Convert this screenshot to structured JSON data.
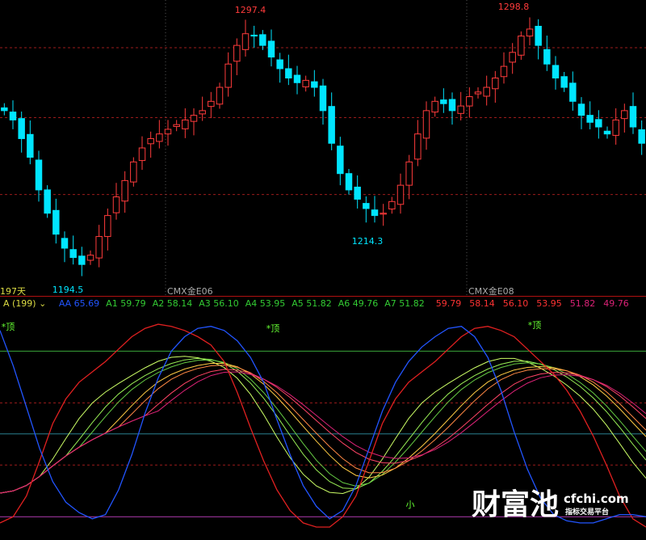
{
  "colors": {
    "up": "#ff3b3b",
    "down": "#00e5ff",
    "grid_red": "#9b1b1b",
    "divider": "#b01010",
    "green_line": "#3aa63a",
    "teal_line": "#2a7f8f",
    "purple_line": "#b03ab0",
    "ma_ribbon": [
      "#ccff66",
      "#99ee55",
      "#66cc44",
      "#ffcc44",
      "#ff8844",
      "#ff4466",
      "#dd2277"
    ]
  },
  "upper": {
    "price_labels": {
      "high1": "1297.4",
      "high2": "1298.8",
      "low1": "1194.5",
      "low2": "1214.3"
    },
    "period_label": "197天",
    "contract_label_1": "CMX金E06",
    "contract_label_2": "CMX金E08"
  },
  "indicator_header": {
    "prefix": "A (199)",
    "caret": "⌄",
    "items": [
      {
        "label": "AA",
        "value": "65.69",
        "color": "#2255ff"
      },
      {
        "label": "A1",
        "value": "59.79",
        "color": "#33cc33"
      },
      {
        "label": "A2",
        "value": "58.14",
        "color": "#33cc33"
      },
      {
        "label": "A3",
        "value": "56.10",
        "color": "#33cc33"
      },
      {
        "label": "A4",
        "value": "53.95",
        "color": "#33cc33"
      },
      {
        "label": "A5",
        "value": "51.82",
        "color": "#33cc33"
      },
      {
        "label": "A6",
        "value": "49.76",
        "color": "#33cc33"
      },
      {
        "label": "A7",
        "value": "51.82",
        "color": "#33cc33"
      }
    ],
    "extra_values": [
      {
        "value": "59.79",
        "color": "#ff3333"
      },
      {
        "value": "58.14",
        "color": "#ff3333"
      },
      {
        "value": "56.10",
        "color": "#ff3333"
      },
      {
        "value": "53.95",
        "color": "#ff3333"
      },
      {
        "value": "51.82",
        "color": "#dd2277"
      },
      {
        "value": "49.76",
        "color": "#dd2277"
      }
    ]
  },
  "signals": {
    "top_label": "*顶",
    "bottom_label": "小"
  },
  "watermark": {
    "brand": "财富池",
    "site": "cfchi.com",
    "slogan": "指标交易平台"
  },
  "chart_data": [
    {
      "type": "candlestick",
      "title": "",
      "xlabel": "",
      "ylabel": "",
      "ylim": [
        1186,
        1306
      ],
      "hlines": [
        1289,
        1259,
        1226
      ],
      "annotations": [
        {
          "text": "1297.4",
          "value": 1297.4
        },
        {
          "text": "1298.8",
          "value": 1298.8
        },
        {
          "text": "1194.5",
          "value": 1194.5
        },
        {
          "text": "1214.3",
          "value": 1214.3
        }
      ],
      "close_path": [
        1262,
        1258,
        1250,
        1242,
        1228,
        1218,
        1209,
        1203,
        1199,
        1196,
        1200,
        1208,
        1217,
        1225,
        1232,
        1240,
        1246,
        1250,
        1252,
        1254,
        1256,
        1258,
        1260,
        1262,
        1266,
        1272,
        1282,
        1290,
        1295,
        1294,
        1290,
        1285,
        1280,
        1276,
        1274,
        1275,
        1272,
        1262,
        1248,
        1235,
        1228,
        1224,
        1220,
        1217,
        1218,
        1223,
        1230,
        1240,
        1252,
        1262,
        1266,
        1265,
        1262,
        1264,
        1268,
        1270,
        1272,
        1276,
        1281,
        1287,
        1294,
        1297,
        1290,
        1282,
        1276,
        1272,
        1266,
        1260,
        1257,
        1255,
        1252,
        1258,
        1262,
        1255,
        1248
      ]
    },
    {
      "type": "line",
      "title": "",
      "ylim": [
        0,
        100
      ],
      "hlines": [
        85,
        60,
        45,
        30,
        5
      ],
      "series": [
        {
          "name": "AA",
          "color": "#2255ff"
        },
        {
          "name": "A1",
          "color": "#ccff66"
        },
        {
          "name": "A2",
          "color": "#99ee55"
        },
        {
          "name": "A3",
          "color": "#66cc44"
        },
        {
          "name": "A4",
          "color": "#ffcc44"
        },
        {
          "name": "A5",
          "color": "#ff8844"
        },
        {
          "name": "A6",
          "color": "#ff4466"
        },
        {
          "name": "A7",
          "color": "#dd2277"
        }
      ],
      "red_series": [
        2,
        5,
        15,
        32,
        50,
        62,
        70,
        75,
        80,
        86,
        92,
        96,
        98,
        97,
        95,
        92,
        88,
        80,
        65,
        48,
        32,
        18,
        8,
        2,
        0,
        0,
        5,
        15,
        32,
        50,
        62,
        70,
        75,
        80,
        86,
        92,
        96,
        97,
        95,
        92,
        86,
        80,
        74,
        66,
        56,
        44,
        30,
        15,
        4,
        0
      ],
      "aa_series": [
        95,
        78,
        58,
        38,
        22,
        12,
        7,
        4,
        6,
        18,
        35,
        55,
        72,
        85,
        92,
        96,
        97,
        95,
        90,
        82,
        70,
        52,
        35,
        20,
        10,
        4,
        8,
        20,
        38,
        56,
        70,
        80,
        87,
        92,
        96,
        97,
        92,
        82,
        66,
        46,
        28,
        14,
        6,
        3,
        2,
        2,
        4,
        6,
        6,
        5
      ]
    }
  ]
}
